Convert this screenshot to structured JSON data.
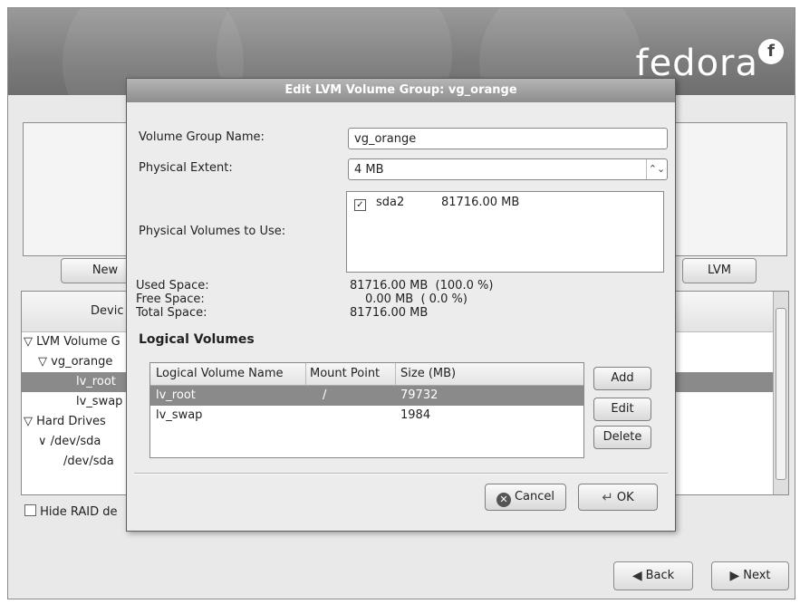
{
  "brand": {
    "name": "fedora",
    "mark": "f"
  },
  "background": {
    "new_button": "New",
    "lvm_button": "LVM",
    "tree_header": "Devic",
    "tree_rows": [
      "LVM Volume G",
      "vg_orange",
      "lv_root",
      "lv_swap",
      "Hard Drives",
      "/dev/sda",
      "/dev/sda"
    ],
    "hide_raid_label": "Hide RAID de",
    "back_button": "Back",
    "next_button": "Next"
  },
  "dialog": {
    "title": "Edit LVM Volume Group: vg_orange",
    "vg_name_label": "Volume Group Name:",
    "vg_name_value": "vg_orange",
    "extent_label": "Physical Extent:",
    "extent_value": "4 MB",
    "pv_label": "Physical Volumes to Use:",
    "pv_items": [
      {
        "checked": true,
        "name": "sda2",
        "size": "81716.00 MB"
      }
    ],
    "used_label": "Used Space:",
    "used_value": "81716.00 MB  (100.0 %)",
    "free_label": "Free Space:",
    "free_value": "0.00 MB  ( 0.0 %)",
    "total_label": "Total Space:",
    "total_value": "81716.00 MB",
    "lv_section": "Logical Volumes",
    "lv_columns": [
      "Logical Volume Name",
      "Mount Point",
      "Size (MB)"
    ],
    "lv_rows": [
      {
        "name": "lv_root",
        "mount": "/",
        "size": "79732",
        "selected": true
      },
      {
        "name": "lv_swap",
        "mount": "",
        "size": "1984",
        "selected": false
      }
    ],
    "add_button": "Add",
    "edit_button": "Edit",
    "delete_button": "Delete",
    "cancel_button": "Cancel",
    "ok_button": "OK"
  }
}
